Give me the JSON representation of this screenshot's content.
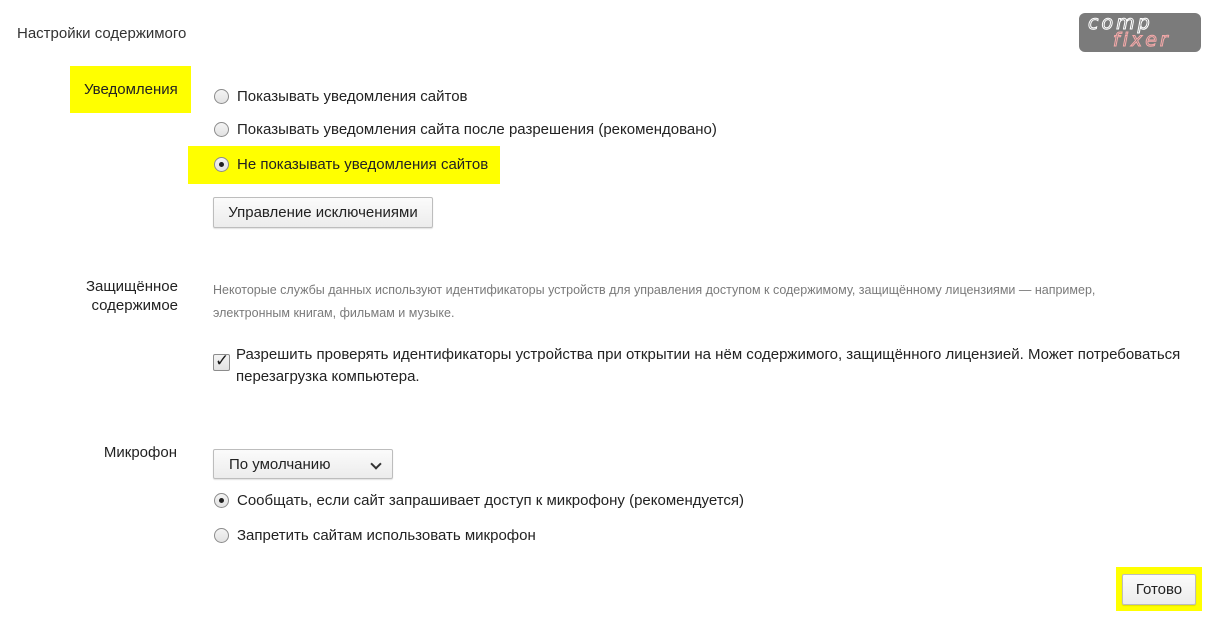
{
  "dialog": {
    "title": "Настройки содержимого"
  },
  "logo": {
    "line1": "comp",
    "line2": "fixer"
  },
  "notifications": {
    "label": "Уведомления",
    "options": [
      "Показывать уведомления сайтов",
      "Показывать уведомления сайта после разрешения (рекомендовано)",
      "Не показывать уведомления сайтов"
    ],
    "selected_index": 2,
    "manage_exceptions_button": "Управление исключениями"
  },
  "protected_content": {
    "label_line1": "Защищённое",
    "label_line2": "содержимое",
    "description_line1": "Некоторые службы данных используют идентификаторы устройств для управления доступом к содержимому, защищённому лицензиями — например,",
    "description_line2": "электронным книгам, фильмам и музыке.",
    "checkbox_checked": true,
    "checkbox_label_line1": "Разрешить проверять идентификаторы устройства при открытии на нём содержимого, защищённого лицензией. Может потребоваться",
    "checkbox_label_line2": "перезагрузка компьютера."
  },
  "microphone": {
    "label": "Микрофон",
    "device_select_value": "По умолчанию",
    "options": [
      "Сообщать, если сайт запрашивает доступ к микрофону (рекомендуется)",
      "Запретить сайтам использовать микрофон"
    ],
    "selected_index": 0
  },
  "footer": {
    "done_button": "Готово"
  },
  "colors": {
    "highlight": "#ffff00",
    "logo_background": "#7b7b7b",
    "logo_accent": "#f6a9a9"
  },
  "icons": {
    "select_arrow": "chevron-down-icon",
    "checkbox_mark": "checkmark-icon"
  }
}
